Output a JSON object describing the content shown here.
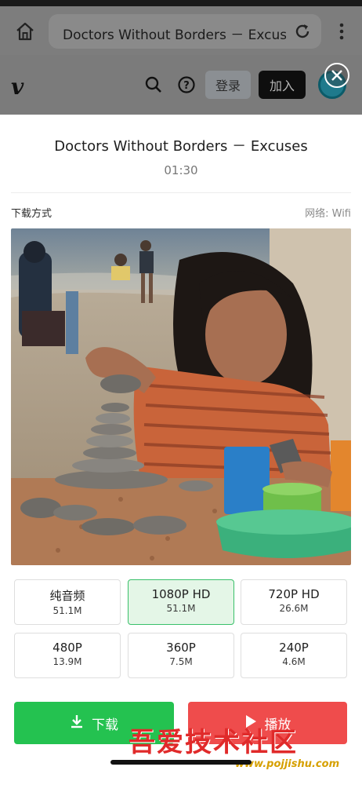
{
  "browser": {
    "url_title": "Doctors Without Borders － Excuse"
  },
  "site": {
    "logo": "v",
    "login_label": "登录",
    "join_label": "加入"
  },
  "sheet": {
    "title": "Doctors Without Borders － Excuses",
    "duration": "01:30",
    "method_label": "下载方式",
    "network_label": "网络: Wifi"
  },
  "options": [
    {
      "label": "纯音频",
      "size": "51.1M",
      "selected": false
    },
    {
      "label": "1080P HD",
      "size": "51.1M",
      "selected": true
    },
    {
      "label": "720P HD",
      "size": "26.6M",
      "selected": false
    },
    {
      "label": "480P",
      "size": "13.9M",
      "selected": false
    },
    {
      "label": "360P",
      "size": "7.5M",
      "selected": false
    },
    {
      "label": "240P",
      "size": "4.6M",
      "selected": false
    }
  ],
  "actions": {
    "download_label": "下载",
    "play_label": "播放"
  },
  "watermark": {
    "text": "吾爱技术社区",
    "url": "www.pojjishu.com"
  },
  "colors": {
    "accent_green": "#24c250",
    "accent_red": "#ef4c4c",
    "selected_bg": "#e4f6e7"
  }
}
